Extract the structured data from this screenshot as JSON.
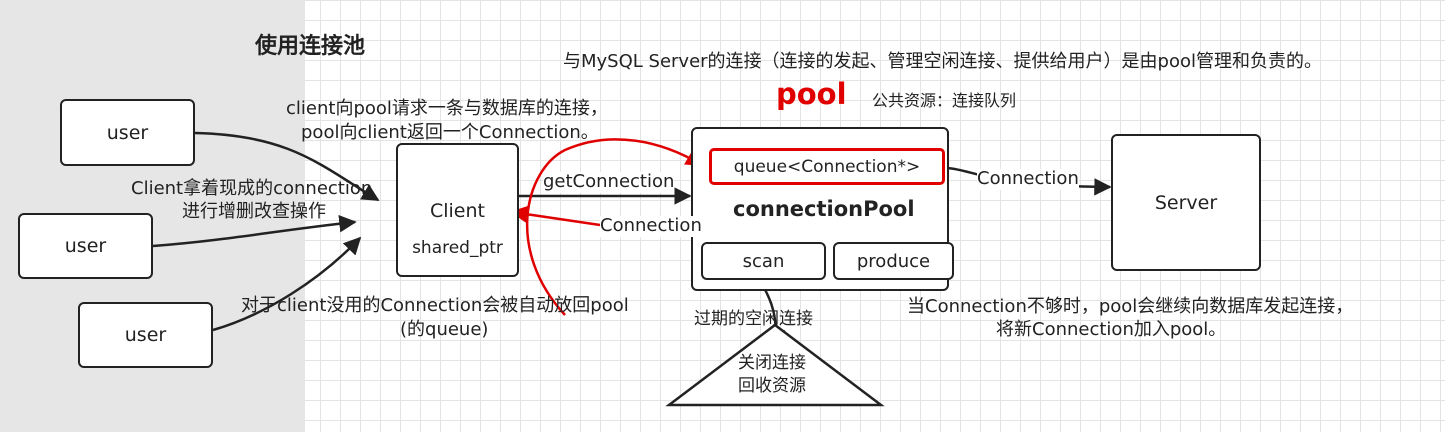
{
  "heading": "使用连接池",
  "top_note": "与MySQL Server的连接（连接的发起、管理空闲连接、提供给用户）是由pool管理和负责的。",
  "pool_title": "pool",
  "pool_resource_note": "公共资源：连接队列",
  "client_request_note": [
    "client向pool请求一条与数据库的连接，",
    "pool向client返回一个Connection。"
  ],
  "client_crud_note": [
    "Client拿着现成的connection",
    "进行增删改查操作"
  ],
  "auto_return_note": [
    "对于client没用的Connection会被自动放回pool",
    "(的queue)"
  ],
  "insufficient_note": [
    "当Connection不够时，pool会继续向数据库发起连接，",
    "将新Connection加入pool。"
  ],
  "expired_note": "过期的空闲连接",
  "close_note": [
    "关闭连接",
    "回收资源"
  ],
  "users": [
    "user",
    "user",
    "user"
  ],
  "client_label": "Client",
  "shared_ptr_label": "shared_ptr",
  "get_connection_label": "getConnection",
  "return_connection_label": "Connection",
  "queue_label": "queue<Connection*>",
  "connection_pool_label": "connectionPool",
  "scan_label": "scan",
  "produce_label": "produce",
  "server_label": "Server",
  "server_connection_label": "Connection",
  "colors": {
    "accent": "#e00000",
    "line": "#222222",
    "left_panel": "#e6e6e6",
    "grid": "#e4e4e4"
  }
}
